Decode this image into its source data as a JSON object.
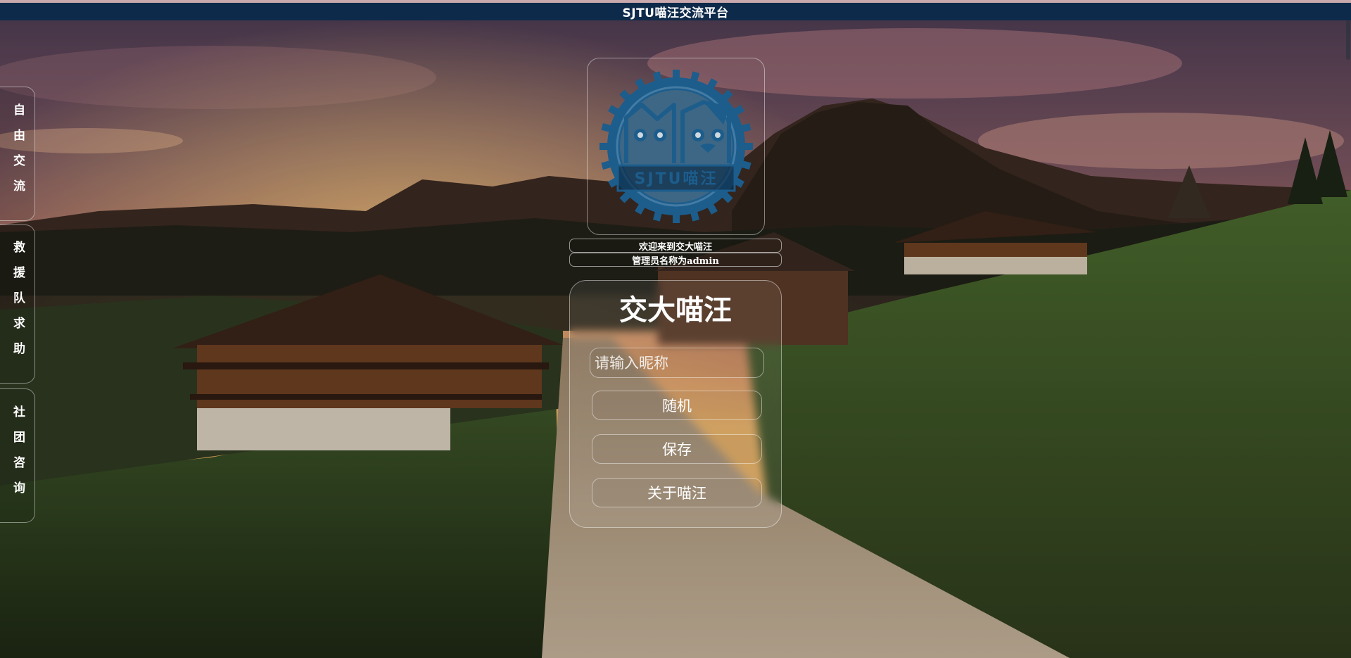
{
  "header": {
    "title": "SJTU喵汪交流平台"
  },
  "sidebar": {
    "items": [
      {
        "label": "自由交流"
      },
      {
        "label": "救援队求助"
      },
      {
        "label": "社团咨询"
      }
    ]
  },
  "logo": {
    "text": "SJTU喵汪",
    "color": "#1c5d8c"
  },
  "welcome": {
    "line1": "欢迎来到交大喵汪",
    "line2": "管理员名称为admin"
  },
  "panel": {
    "title": "交大喵汪",
    "nickname_placeholder": "请输入昵称",
    "nickname_value": "",
    "random_label": "随机",
    "save_label": "保存",
    "about_label": "关于喵汪"
  },
  "colors": {
    "header_bg": "#0e2a4a",
    "logo_blue": "#1c5d8c"
  }
}
